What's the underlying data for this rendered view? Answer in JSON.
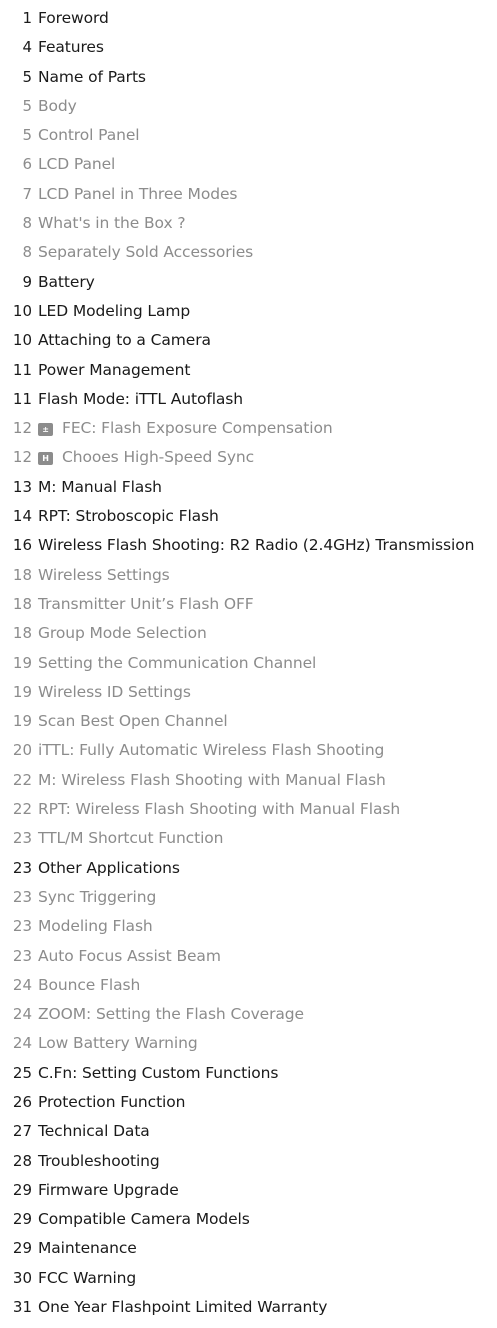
{
  "toc": [
    {
      "page": "1",
      "title": "Foreword",
      "level": "main"
    },
    {
      "page": "4",
      "title": "Features",
      "level": "main"
    },
    {
      "page": "5",
      "title": "Name of Parts",
      "level": "main"
    },
    {
      "page": "5",
      "title": "Body",
      "level": "sub"
    },
    {
      "page": "5",
      "title": "Control Panel",
      "level": "sub"
    },
    {
      "page": "6",
      "title": "LCD Panel",
      "level": "sub"
    },
    {
      "page": "7",
      "title": "LCD Panel in Three Modes",
      "level": "sub"
    },
    {
      "page": "8",
      "title": "What's in the Box ?",
      "level": "sub"
    },
    {
      "page": "8",
      "title": "Separately Sold Accessories",
      "level": "sub"
    },
    {
      "page": "9",
      "title": "Battery",
      "level": "main"
    },
    {
      "page": "10",
      "title": "LED Modeling Lamp",
      "level": "main"
    },
    {
      "page": "10",
      "title": "Attaching to a Camera",
      "level": "main"
    },
    {
      "page": "11",
      "title": "Power Management",
      "level": "main"
    },
    {
      "page": "11",
      "title": "Flash Mode: iTTL Autoflash",
      "level": "main"
    },
    {
      "page": "12",
      "title": "FEC: Flash Exposure Compensation",
      "level": "sub",
      "icon": "fec-icon",
      "icon_text": "±"
    },
    {
      "page": "12",
      "title": "Chooes High-Speed Sync",
      "level": "sub",
      "icon": "high-speed-sync-icon",
      "icon_text": "H"
    },
    {
      "page": "13",
      "title": "M: Manual Flash",
      "level": "main"
    },
    {
      "page": "14",
      "title": "RPT: Stroboscopic Flash",
      "level": "main"
    },
    {
      "page": "16",
      "title": "Wireless Flash Shooting: R2 Radio (2.4GHz) Transmission",
      "level": "main"
    },
    {
      "page": "18",
      "title": "Wireless Settings",
      "level": "sub"
    },
    {
      "page": "18",
      "title": "Transmitter Unit’s Flash OFF",
      "level": "sub"
    },
    {
      "page": "18",
      "title": "Group Mode Selection",
      "level": "sub"
    },
    {
      "page": "19",
      "title": "Setting the Communication Channel",
      "level": "sub"
    },
    {
      "page": "19",
      "title": "Wireless ID Settings",
      "level": "sub"
    },
    {
      "page": "19",
      "title": "Scan Best Open Channel",
      "level": "sub"
    },
    {
      "page": "20",
      "title": "iTTL: Fully Automatic Wireless Flash Shooting",
      "level": "sub"
    },
    {
      "page": "22",
      "title": "M: Wireless Flash Shooting with Manual Flash",
      "level": "sub"
    },
    {
      "page": "22",
      "title": "RPT: Wireless Flash Shooting with Manual Flash",
      "level": "sub"
    },
    {
      "page": "23",
      "title": "TTL/M Shortcut Function",
      "level": "sub"
    },
    {
      "page": "23",
      "title": "Other Applications",
      "level": "main"
    },
    {
      "page": "23",
      "title": "Sync Triggering",
      "level": "sub"
    },
    {
      "page": "23",
      "title": "Modeling Flash",
      "level": "sub"
    },
    {
      "page": "23",
      "title": "Auto Focus Assist Beam",
      "level": "sub"
    },
    {
      "page": "24",
      "title": "Bounce Flash",
      "level": "sub"
    },
    {
      "page": "24",
      "title": "ZOOM: Setting the Flash Coverage",
      "level": "sub"
    },
    {
      "page": "24",
      "title": "Low Battery Warning",
      "level": "sub"
    },
    {
      "page": "25",
      "title": "C.Fn: Setting Custom Functions",
      "level": "main"
    },
    {
      "page": "26",
      "title": "Protection Function",
      "level": "main"
    },
    {
      "page": "27",
      "title": "Technical Data",
      "level": "main"
    },
    {
      "page": "28",
      "title": "Troubleshooting",
      "level": "main"
    },
    {
      "page": "29",
      "title": "Firmware Upgrade",
      "level": "main"
    },
    {
      "page": "29",
      "title": "Compatible Camera Models",
      "level": "main"
    },
    {
      "page": "29",
      "title": "Maintenance",
      "level": "main"
    },
    {
      "page": "30",
      "title": "FCC Warning",
      "level": "main"
    },
    {
      "page": "31",
      "title": "One Year Flashpoint Limited Warranty",
      "level": "main"
    }
  ]
}
